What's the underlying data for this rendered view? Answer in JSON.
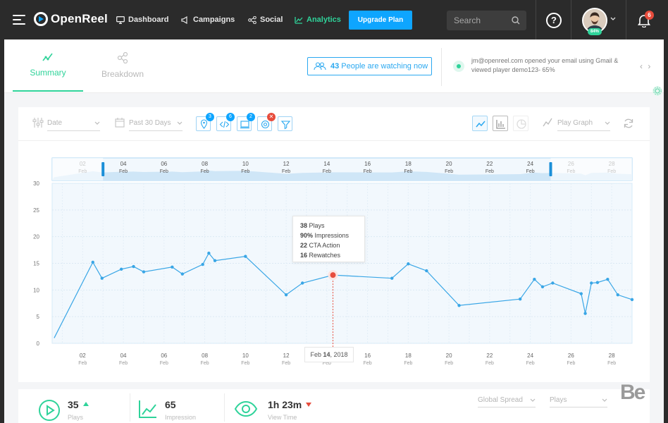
{
  "app": {
    "name": "OpenReel"
  },
  "nav": {
    "items": [
      {
        "label": "Dashboard"
      },
      {
        "label": "Campaigns"
      },
      {
        "label": "Social"
      },
      {
        "label": "Analytics"
      }
    ],
    "upgrade_label": "Upgrade Plan",
    "search_placeholder": "Search",
    "help_label": "?",
    "avatar_badge": "84%",
    "notifications_count": "6"
  },
  "tabs": [
    {
      "label": "Summary",
      "active": true
    },
    {
      "label": "Breakdown",
      "active": false
    }
  ],
  "watching": {
    "count": "43",
    "text": "People are watching now"
  },
  "notification": {
    "text": "jm@openreel.com opened your email using Gmail & viewed player demo123- 65%",
    "nav": "‹ ›"
  },
  "toolbar": {
    "date_filter": "Date",
    "range_filter": "Past 30 Days",
    "badges": [
      "3",
      "6",
      "2",
      "✕"
    ],
    "graph_filter": "Play Graph"
  },
  "colors": {
    "accent_green": "#2fd39a",
    "accent_blue": "#0ea5ff",
    "line": "#39a6e6",
    "highlight": "#e74c3c"
  },
  "chart_data": {
    "type": "line",
    "ylim": [
      0,
      30
    ],
    "y_ticks": [
      "0",
      "5",
      "10",
      "15",
      "20",
      "25",
      "30"
    ],
    "x_ticks": [
      {
        "day": "02",
        "mon": "Feb",
        "x": 2
      },
      {
        "day": "04",
        "mon": "Feb",
        "x": 4
      },
      {
        "day": "06",
        "mon": "Feb",
        "x": 6
      },
      {
        "day": "08",
        "mon": "Feb",
        "x": 8
      },
      {
        "day": "10",
        "mon": "Feb",
        "x": 10
      },
      {
        "day": "12",
        "mon": "Feb",
        "x": 12
      },
      {
        "day": "14",
        "mon": "Feb",
        "x": 14
      },
      {
        "day": "16",
        "mon": "Feb",
        "x": 16
      },
      {
        "day": "18",
        "mon": "Feb",
        "x": 18
      },
      {
        "day": "20",
        "mon": "Feb",
        "x": 20
      },
      {
        "day": "22",
        "mon": "Feb",
        "x": 22
      },
      {
        "day": "24",
        "mon": "Feb",
        "x": 24
      },
      {
        "day": "26",
        "mon": "Feb",
        "x": 26
      },
      {
        "day": "28",
        "mon": "Feb",
        "x": 28
      }
    ],
    "series": [
      {
        "points": [
          [
            0.6,
            1.0
          ],
          [
            2.5,
            15.2
          ],
          [
            2.95,
            12.2
          ],
          [
            3.9,
            13.9
          ],
          [
            4.5,
            14.4
          ],
          [
            5.0,
            13.4
          ],
          [
            6.4,
            14.3
          ],
          [
            6.9,
            13.0
          ],
          [
            7.9,
            14.8
          ],
          [
            8.2,
            16.9
          ],
          [
            8.5,
            15.5
          ],
          [
            10.0,
            16.3
          ],
          [
            12.0,
            9.1
          ],
          [
            12.8,
            11.3
          ],
          [
            14.3,
            12.8
          ],
          [
            17.2,
            12.2
          ],
          [
            18.0,
            14.9
          ],
          [
            18.9,
            13.6
          ],
          [
            20.5,
            7.1
          ],
          [
            23.5,
            8.3
          ],
          [
            24.2,
            12.0
          ],
          [
            24.6,
            10.6
          ],
          [
            25.1,
            11.3
          ],
          [
            26.5,
            9.3
          ],
          [
            26.7,
            5.6
          ],
          [
            27.0,
            11.3
          ],
          [
            27.3,
            11.4
          ],
          [
            27.8,
            12.0
          ],
          [
            28.3,
            9.1
          ],
          [
            29.0,
            8.2
          ]
        ]
      }
    ],
    "highlight": {
      "x": 14.3,
      "y": 12.8,
      "date_day": "14",
      "date_label": "Feb",
      "date_year": ", 2018"
    },
    "tooltip": [
      {
        "value": "38",
        "label": "Plays"
      },
      {
        "value": "90%",
        "label": "Impressions"
      },
      {
        "value": "22",
        "label": "CTA Action"
      },
      {
        "value": "16",
        "label": "Rewatches"
      }
    ],
    "navigator_ticks": [
      {
        "day": "02",
        "mon": "Feb",
        "x": 2
      },
      {
        "day": "04",
        "mon": "Feb",
        "x": 4
      },
      {
        "day": "06",
        "mon": "Feb",
        "x": 6
      },
      {
        "day": "08",
        "mon": "Feb",
        "x": 8
      },
      {
        "day": "10",
        "mon": "Feb",
        "x": 10
      },
      {
        "day": "12",
        "mon": "Feb",
        "x": 12
      },
      {
        "day": "14",
        "mon": "Feb",
        "x": 14
      },
      {
        "day": "16",
        "mon": "Feb",
        "x": 16
      },
      {
        "day": "18",
        "mon": "Feb",
        "x": 18
      },
      {
        "day": "20",
        "mon": "Feb",
        "x": 20
      },
      {
        "day": "22",
        "mon": "Feb",
        "x": 22
      },
      {
        "day": "24",
        "mon": "Feb",
        "x": 24
      },
      {
        "day": "26",
        "mon": "Feb",
        "x": 26
      },
      {
        "day": "28",
        "mon": "Feb",
        "x": 28
      }
    ],
    "navigator_range": [
      3,
      25
    ]
  },
  "stats": [
    {
      "value": "35",
      "label": "Plays",
      "trend": "up"
    },
    {
      "value": "65",
      "label": "Impression",
      "trend": ""
    },
    {
      "value": "1h 23m",
      "label": "View Time",
      "trend": "down"
    }
  ],
  "bottom_dropdowns": [
    "Global Spread",
    "Plays"
  ],
  "watermark": "Be"
}
